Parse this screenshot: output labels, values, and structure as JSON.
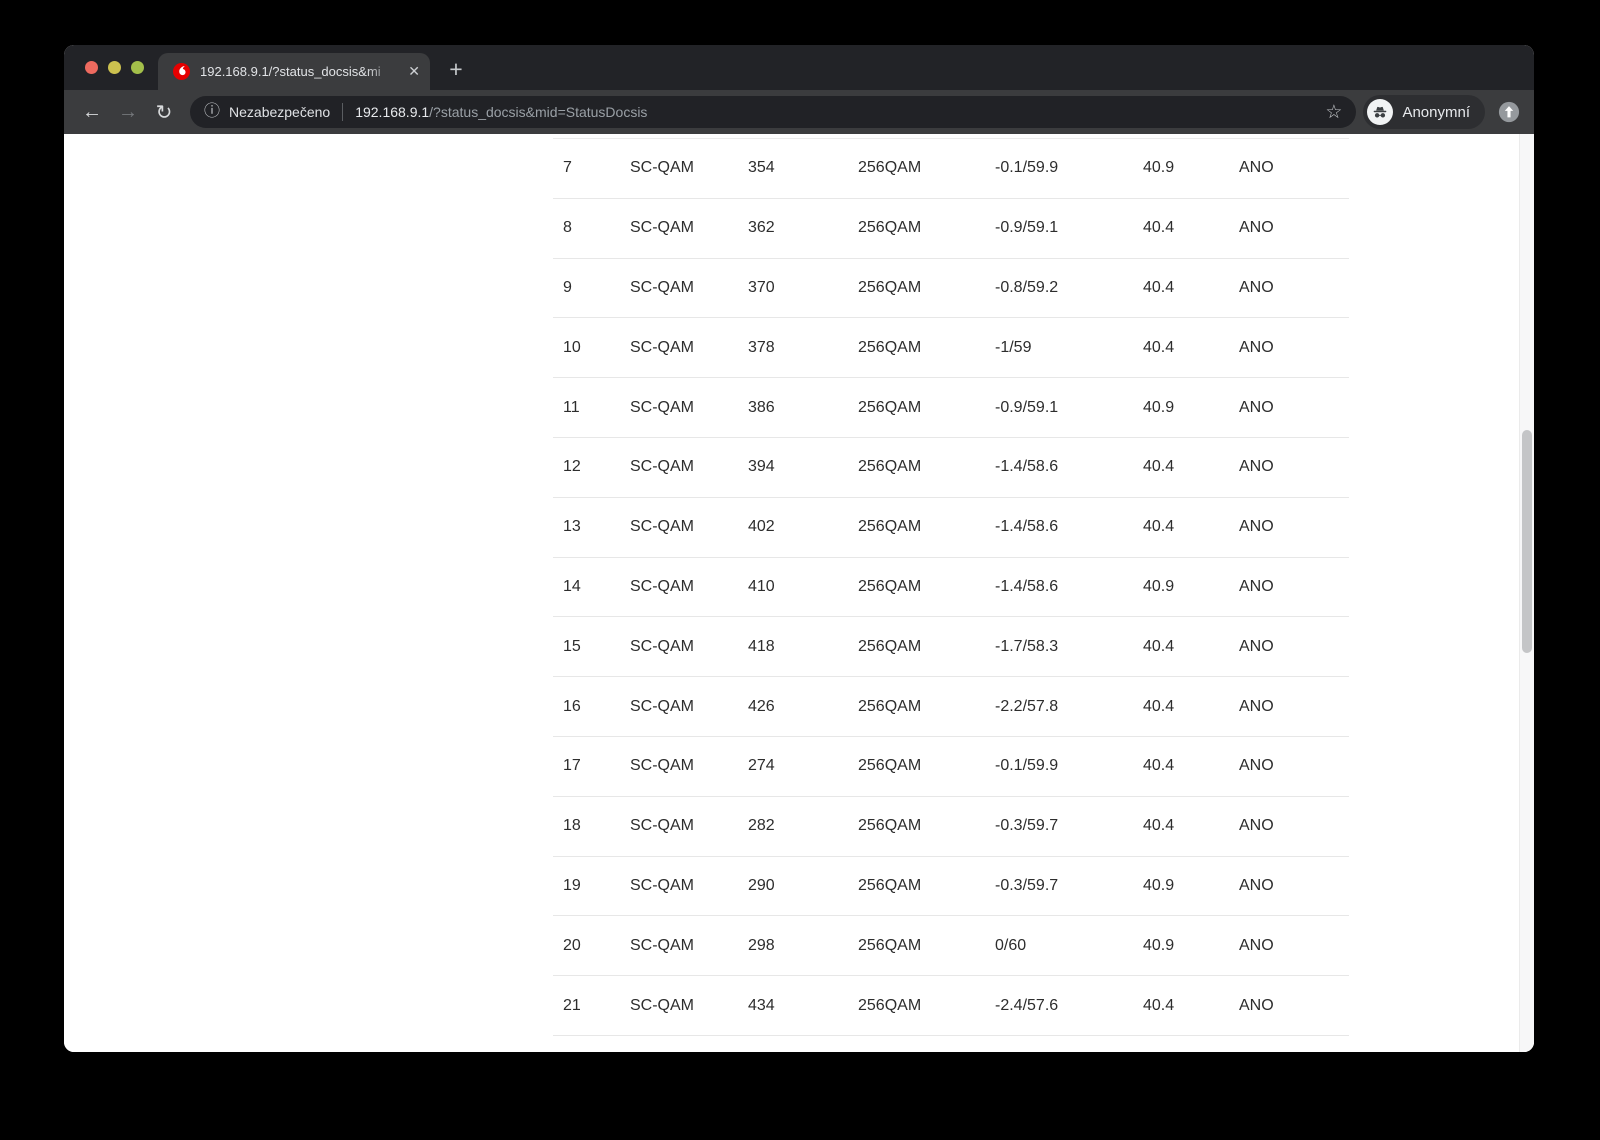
{
  "browser": {
    "tab": {
      "title": "192.168.9.1/?status_docsis&mi"
    },
    "address_bar": {
      "security_label": "Nezabezpečeno",
      "url_host": "192.168.9.1",
      "url_path": "/?status_docsis&mid=StatusDocsis"
    },
    "profile": {
      "label": "Anonymní"
    },
    "icons": {
      "close": "✕",
      "new_tab": "+",
      "back": "←",
      "forward": "→",
      "reload": "↻",
      "info": "ⓘ",
      "star": "☆"
    },
    "colors": {
      "favicon_red": "#e60000",
      "frame": "#222327",
      "toolbar": "#3b3c3e",
      "omnibox": "#212226",
      "scrollbar_thumb": "#c4c5c7"
    }
  },
  "page": {
    "table": {
      "rows": [
        [
          "7",
          "SC-QAM",
          "354",
          "256QAM",
          "-0.1/59.9",
          "40.9",
          "ANO"
        ],
        [
          "8",
          "SC-QAM",
          "362",
          "256QAM",
          "-0.9/59.1",
          "40.4",
          "ANO"
        ],
        [
          "9",
          "SC-QAM",
          "370",
          "256QAM",
          "-0.8/59.2",
          "40.4",
          "ANO"
        ],
        [
          "10",
          "SC-QAM",
          "378",
          "256QAM",
          "-1/59",
          "40.4",
          "ANO"
        ],
        [
          "11",
          "SC-QAM",
          "386",
          "256QAM",
          "-0.9/59.1",
          "40.9",
          "ANO"
        ],
        [
          "12",
          "SC-QAM",
          "394",
          "256QAM",
          "-1.4/58.6",
          "40.4",
          "ANO"
        ],
        [
          "13",
          "SC-QAM",
          "402",
          "256QAM",
          "-1.4/58.6",
          "40.4",
          "ANO"
        ],
        [
          "14",
          "SC-QAM",
          "410",
          "256QAM",
          "-1.4/58.6",
          "40.9",
          "ANO"
        ],
        [
          "15",
          "SC-QAM",
          "418",
          "256QAM",
          "-1.7/58.3",
          "40.4",
          "ANO"
        ],
        [
          "16",
          "SC-QAM",
          "426",
          "256QAM",
          "-2.2/57.8",
          "40.4",
          "ANO"
        ],
        [
          "17",
          "SC-QAM",
          "274",
          "256QAM",
          "-0.1/59.9",
          "40.4",
          "ANO"
        ],
        [
          "18",
          "SC-QAM",
          "282",
          "256QAM",
          "-0.3/59.7",
          "40.4",
          "ANO"
        ],
        [
          "19",
          "SC-QAM",
          "290",
          "256QAM",
          "-0.3/59.7",
          "40.9",
          "ANO"
        ],
        [
          "20",
          "SC-QAM",
          "298",
          "256QAM",
          "0/60",
          "40.9",
          "ANO"
        ],
        [
          "21",
          "SC-QAM",
          "434",
          "256QAM",
          "-2.4/57.6",
          "40.4",
          "ANO"
        ]
      ]
    }
  }
}
